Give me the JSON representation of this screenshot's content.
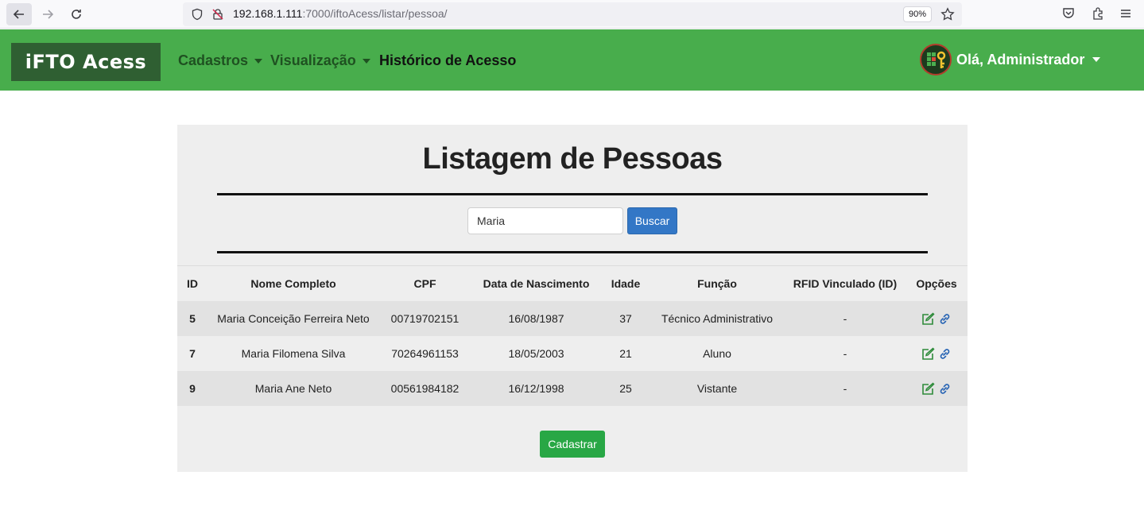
{
  "browser": {
    "url_host": "192.168.1.111",
    "url_path": ":7000/iftoAcess/listar/pessoa/",
    "zoom": "90%"
  },
  "navbar": {
    "brand": "iFTO Acess",
    "items": [
      {
        "label": "Cadastros"
      },
      {
        "label": "Visualização"
      },
      {
        "label": "Histórico de Acesso"
      }
    ],
    "user_label": "Olá, Administrador"
  },
  "main": {
    "title": "Listagem de Pessoas",
    "search": {
      "value": "Maria",
      "button": "Buscar"
    },
    "table": {
      "headers": [
        "ID",
        "Nome Completo",
        "CPF",
        "Data de Nascimento",
        "Idade",
        "Função",
        "RFID Vinculado (ID)",
        "Opções"
      ],
      "rows": [
        {
          "id": "5",
          "nome": "Maria Conceição Ferreira Neto",
          "cpf": "00719702151",
          "data": "16/08/1987",
          "idade": "37",
          "funcao": "Técnico Administrativo",
          "rfid": "-"
        },
        {
          "id": "7",
          "nome": "Maria Filomena Silva",
          "cpf": "70264961153",
          "data": "18/05/2003",
          "idade": "21",
          "funcao": "Aluno",
          "rfid": "-"
        },
        {
          "id": "9",
          "nome": "Maria Ane Neto",
          "cpf": "00561984182",
          "data": "16/12/1998",
          "idade": "25",
          "funcao": "Vistante",
          "rfid": "-"
        }
      ]
    },
    "cadastrar_button": "Cadastrar"
  },
  "colors": {
    "navbar": "#48ad4c",
    "brand_bg": "#2f5f32",
    "search_button": "#3377c6",
    "cadastrar_button": "#28a745",
    "edit_icon": "#2e8b3a",
    "link_icon": "#2a66b5"
  },
  "icons": [
    "back-icon",
    "forward-icon",
    "reload-icon",
    "shield-icon",
    "lock-icon",
    "star-icon",
    "pocket-icon",
    "extensions-icon",
    "menu-icon",
    "edit-icon",
    "link-icon"
  ]
}
